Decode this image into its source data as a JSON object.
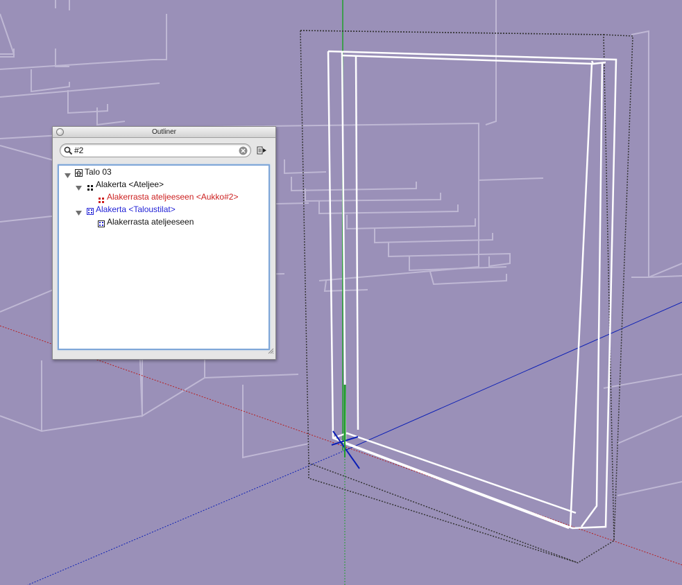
{
  "outliner": {
    "title": "Outliner",
    "search": {
      "value": "#2",
      "search_icon": "magnifier-icon",
      "clear_icon": "clear-search-icon"
    },
    "details_icon": "details-arrow-icon",
    "tree": [
      {
        "label": "Talo 03",
        "level": 0,
        "expanded": true,
        "icon": "model-icon",
        "state": "normal"
      },
      {
        "label": "Alakerta <Ateljee>",
        "level": 1,
        "expanded": true,
        "icon": "group-icon",
        "state": "normal"
      },
      {
        "label": "Alakerrasta ateljeeseen <Aukko#2>",
        "level": 2,
        "expanded": null,
        "icon": "component-icon",
        "state": "match"
      },
      {
        "label": "Alakerta <Taloustilat>",
        "level": 1,
        "expanded": true,
        "icon": "component-icon",
        "state": "selected"
      },
      {
        "label": "Alakerrasta ateljeeseen",
        "level": 2,
        "expanded": null,
        "icon": "component-icon",
        "state": "normal"
      }
    ]
  },
  "colors": {
    "background": "#9a90b8",
    "match_text": "#cc1f1f",
    "selected_text": "#2323d6",
    "green_axis": "#1fa02a",
    "blue_axis": "#0a1eb5",
    "red_axis": "#b81c1c"
  }
}
